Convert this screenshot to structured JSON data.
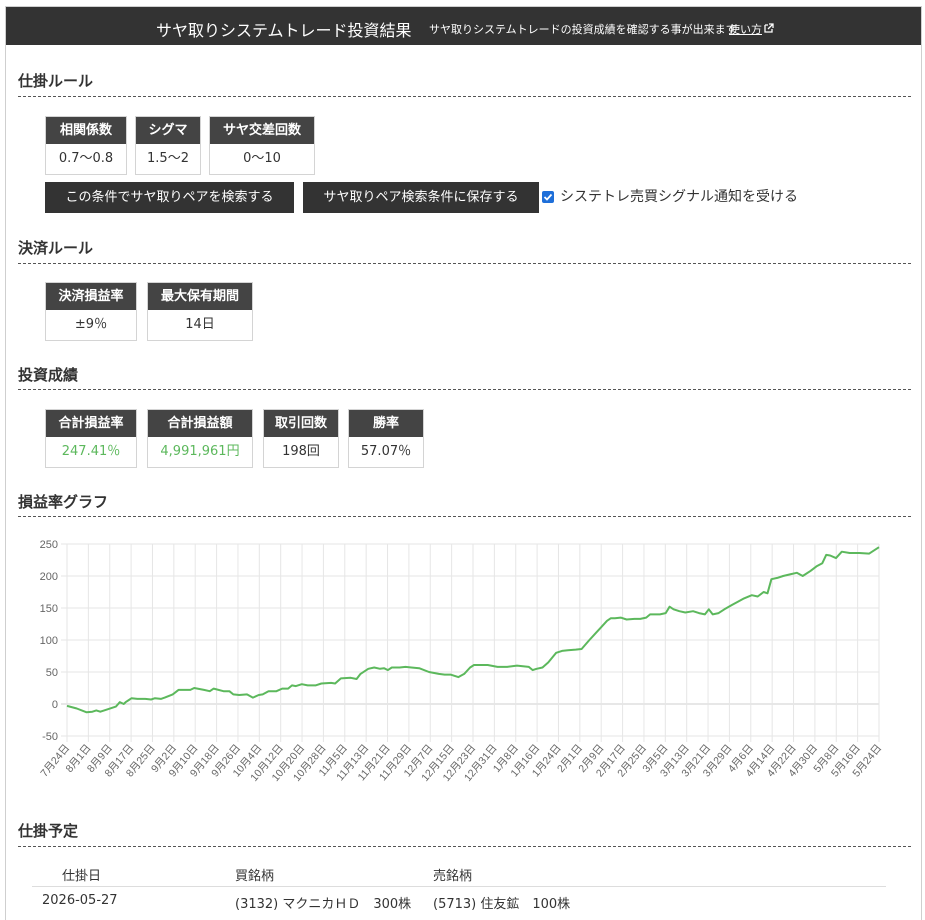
{
  "header": {
    "title": "サヤ取りシステムトレード投資結果",
    "subtitle": "サヤ取りシステムトレードの投資成績を確認する事が出来ます",
    "howto_label": "使い方",
    "external_icon": "external-link-icon"
  },
  "entry_rules": {
    "title": "仕掛ルール",
    "params": [
      {
        "label": "相関係数",
        "value": "0.7～0.8"
      },
      {
        "label": "シグマ",
        "value": "1.5～2"
      },
      {
        "label": "サヤ交差回数",
        "value": "0～10"
      }
    ],
    "search_button": "この条件でサヤ取りペアを検索する",
    "save_button": "サヤ取りペア検索条件に保存する",
    "notify_checkbox": {
      "label": "システトレ売買シグナル通知を受ける",
      "checked": true
    }
  },
  "exit_rules": {
    "title": "決済ルール",
    "params": [
      {
        "label": "決済損益率",
        "value": "±9％"
      },
      {
        "label": "最大保有期間",
        "value": "14日"
      }
    ]
  },
  "results": {
    "title": "投資成績",
    "params": [
      {
        "label": "合計損益率",
        "value": "247.41％"
      },
      {
        "label": "合計損益額",
        "value": "4,991,961円"
      },
      {
        "label": "取引回数",
        "value": "198回"
      },
      {
        "label": "勝率",
        "value": "57.07％"
      }
    ],
    "positive_color": "#5cb85c"
  },
  "chart_section": {
    "title": "損益率グラフ"
  },
  "chart_data": {
    "type": "line",
    "ylim": [
      -50,
      250
    ],
    "yticks": [
      "250",
      "200",
      "150",
      "100",
      "50",
      "0",
      "-50"
    ],
    "x_tick_labels": [
      "7月24日",
      "8月1日",
      "8月9日",
      "8月17日",
      "8月25日",
      "9月2日",
      "9月10日",
      "9月18日",
      "9月26日",
      "10月4日",
      "10月12日",
      "10月20日",
      "10月28日",
      "11月5日",
      "11月13日",
      "11月21日",
      "11月29日",
      "12月7日",
      "12月15日",
      "12月23日",
      "12月31日",
      "1月8日",
      "1月16日",
      "1月24日",
      "2月1日",
      "2月9日",
      "2月17日",
      "2月25日",
      "3月5日",
      "3月13日",
      "3月21日",
      "3月29日",
      "4月6日",
      "4月14日",
      "4月22日",
      "4月30日",
      "5月8日",
      "5月16日",
      "5月24日"
    ],
    "series": [
      {
        "color": "#5cb85c",
        "points": [
          [
            0,
            -3
          ],
          [
            0.5,
            -7
          ],
          [
            1,
            -13
          ],
          [
            1.3,
            -12
          ],
          [
            1.5,
            -10
          ],
          [
            1.7,
            -12
          ],
          [
            2,
            -9
          ],
          [
            2.5,
            -4
          ],
          [
            2.7,
            3
          ],
          [
            2.9,
            0
          ],
          [
            3,
            3
          ],
          [
            3.3,
            9
          ],
          [
            3.6,
            8
          ],
          [
            4,
            8
          ],
          [
            4.3,
            7
          ],
          [
            4.5,
            9
          ],
          [
            4.8,
            8
          ],
          [
            5,
            10
          ],
          [
            5.4,
            15
          ],
          [
            5.7,
            22
          ],
          [
            6,
            22
          ],
          [
            6.3,
            22
          ],
          [
            6.5,
            25
          ],
          [
            7,
            22
          ],
          [
            7.3,
            20
          ],
          [
            7.5,
            24
          ],
          [
            8,
            20
          ],
          [
            8.3,
            20
          ],
          [
            8.5,
            15
          ],
          [
            8.8,
            14
          ],
          [
            9.2,
            15
          ],
          [
            9.5,
            10
          ],
          [
            9.8,
            14
          ],
          [
            10,
            15
          ],
          [
            10.3,
            20
          ],
          [
            10.7,
            20
          ],
          [
            11,
            24
          ],
          [
            11.3,
            24
          ],
          [
            11.5,
            29
          ],
          [
            11.7,
            28
          ],
          [
            12,
            31
          ],
          [
            12.3,
            29
          ],
          [
            12.7,
            29
          ],
          [
            13,
            32
          ],
          [
            13.5,
            33
          ],
          [
            13.7,
            32
          ],
          [
            14,
            40
          ],
          [
            14.5,
            41
          ],
          [
            14.8,
            39
          ],
          [
            15,
            47
          ],
          [
            15.4,
            55
          ],
          [
            15.7,
            57
          ],
          [
            16,
            55
          ],
          [
            16.2,
            56
          ],
          [
            16.4,
            53
          ],
          [
            16.6,
            57
          ],
          [
            17,
            57
          ],
          [
            17.3,
            58
          ],
          [
            17.6,
            57
          ],
          [
            18,
            56
          ],
          [
            18.5,
            50
          ],
          [
            19,
            47
          ],
          [
            19.3,
            46
          ],
          [
            19.6,
            46
          ],
          [
            20,
            42
          ],
          [
            20.3,
            47
          ],
          [
            20.6,
            57
          ],
          [
            20.8,
            61
          ],
          [
            21,
            61
          ],
          [
            21.5,
            61
          ],
          [
            22,
            58
          ],
          [
            22.5,
            58
          ],
          [
            23,
            60
          ],
          [
            23.3,
            59
          ],
          [
            23.6,
            58
          ],
          [
            23.8,
            53
          ],
          [
            24,
            55
          ],
          [
            24.3,
            57
          ],
          [
            24.6,
            65
          ],
          [
            25,
            80
          ],
          [
            25.3,
            83
          ],
          [
            25.6,
            84
          ],
          [
            26,
            85
          ],
          [
            26.3,
            86
          ],
          [
            26.7,
            100
          ],
          [
            27,
            110
          ],
          [
            27.3,
            120
          ],
          [
            27.6,
            130
          ],
          [
            27.8,
            134
          ],
          [
            28,
            134
          ],
          [
            28.3,
            135
          ],
          [
            28.6,
            132
          ],
          [
            29,
            133
          ],
          [
            29.3,
            133
          ],
          [
            29.6,
            135
          ],
          [
            29.8,
            140
          ],
          [
            30,
            140
          ],
          [
            30.3,
            140
          ],
          [
            30.6,
            142
          ],
          [
            30.8,
            152
          ],
          [
            31,
            148
          ],
          [
            31.3,
            145
          ],
          [
            31.6,
            143
          ],
          [
            32,
            145
          ],
          [
            32.3,
            142
          ],
          [
            32.6,
            140
          ],
          [
            32.8,
            148
          ],
          [
            33,
            140
          ],
          [
            33.3,
            142
          ],
          [
            33.6,
            148
          ],
          [
            34,
            155
          ],
          [
            34.3,
            160
          ],
          [
            34.6,
            165
          ],
          [
            35,
            170
          ],
          [
            35.3,
            168
          ],
          [
            35.6,
            175
          ],
          [
            35.8,
            173
          ],
          [
            36,
            195
          ],
          [
            36.3,
            197
          ],
          [
            36.6,
            200
          ],
          [
            37,
            203
          ],
          [
            37.3,
            205
          ],
          [
            37.6,
            200
          ],
          [
            38,
            208
          ],
          [
            38.3,
            215
          ],
          [
            38.6,
            220
          ],
          [
            38.8,
            233
          ],
          [
            39,
            232
          ],
          [
            39.3,
            228
          ],
          [
            39.6,
            238
          ],
          [
            40,
            236
          ],
          [
            40.5,
            236
          ],
          [
            41,
            235
          ],
          [
            41.5,
            245
          ]
        ]
      }
    ],
    "grid": true,
    "legend": "none"
  },
  "schedule": {
    "title": "仕掛予定",
    "columns": [
      "仕掛日",
      "買銘柄",
      "売銘柄"
    ],
    "rows": [
      {
        "date": "2026-05-27",
        "buy": "(3132) マクニカＨＤ　300株",
        "sell": "(5713) 住友鉱　100株"
      }
    ]
  }
}
